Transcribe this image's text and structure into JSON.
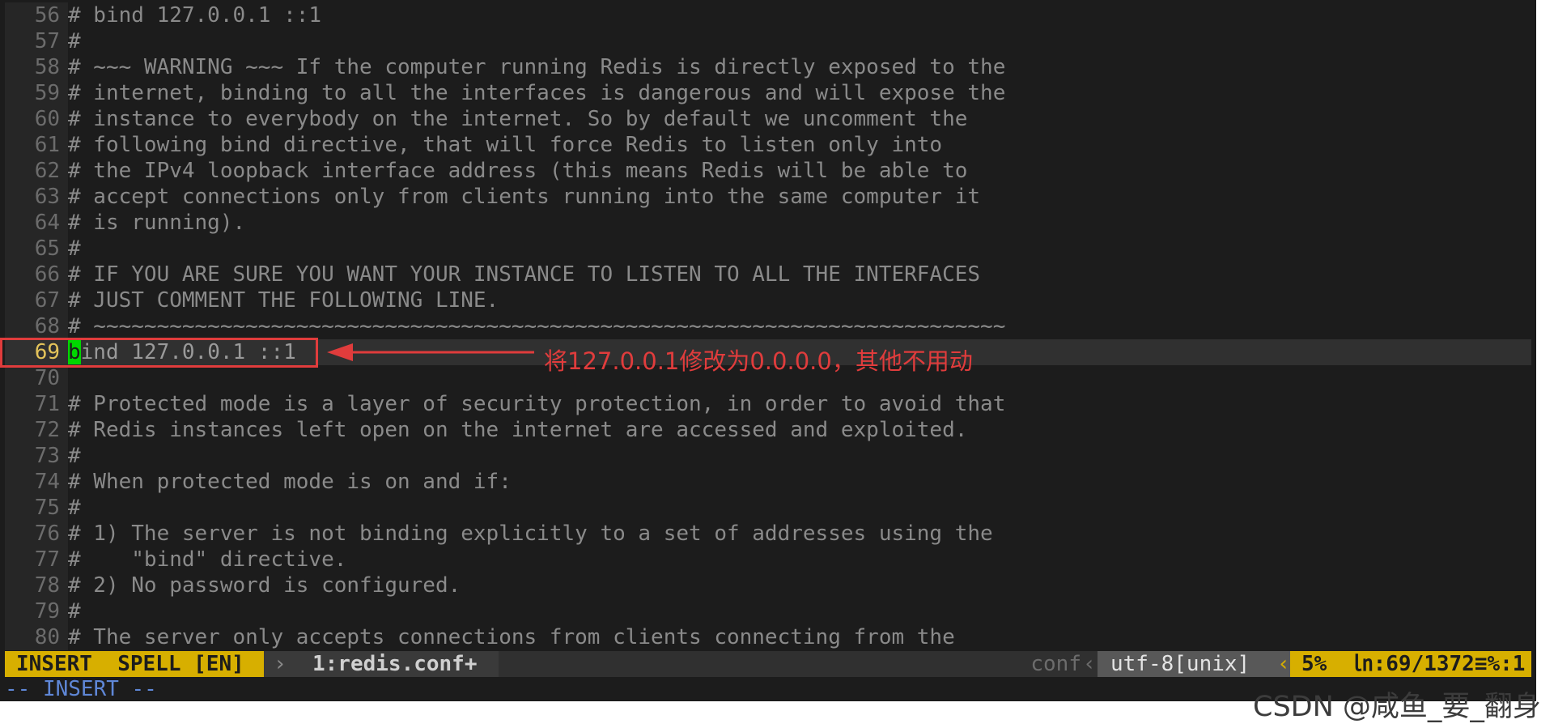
{
  "editor": {
    "lines": [
      {
        "num": "56",
        "text": "# bind 127.0.0.1 ::1"
      },
      {
        "num": "57",
        "text": "#"
      },
      {
        "num": "58",
        "text": "# ~~~ WARNING ~~~ If the computer running Redis is directly exposed to the"
      },
      {
        "num": "59",
        "text": "# internet, binding to all the interfaces is dangerous and will expose the"
      },
      {
        "num": "60",
        "text": "# instance to everybody on the internet. So by default we uncomment the"
      },
      {
        "num": "61",
        "text": "# following bind directive, that will force Redis to listen only into"
      },
      {
        "num": "62",
        "text": "# the IPv4 loopback interface address (this means Redis will be able to"
      },
      {
        "num": "63",
        "text": "# accept connections only from clients running into the same computer it"
      },
      {
        "num": "64",
        "text": "# is running)."
      },
      {
        "num": "65",
        "text": "#"
      },
      {
        "num": "66",
        "text": "# IF YOU ARE SURE YOU WANT YOUR INSTANCE TO LISTEN TO ALL THE INTERFACES"
      },
      {
        "num": "67",
        "text": "# JUST COMMENT THE FOLLOWING LINE."
      },
      {
        "num": "68",
        "text": "# ~~~~~~~~~~~~~~~~~~~~~~~~~~~~~~~~~~~~~~~~~~~~~~~~~~~~~~~~~~~~~~~~~~~~~~~~"
      },
      {
        "num": "69",
        "cursor_char": "b",
        "text": "ind 127.0.0.1 ::1",
        "current": true
      },
      {
        "num": "70",
        "text": ""
      },
      {
        "num": "71",
        "text": "# Protected mode is a layer of security protection, in order to avoid that"
      },
      {
        "num": "72",
        "text": "# Redis instances left open on the internet are accessed and exploited."
      },
      {
        "num": "73",
        "text": "#"
      },
      {
        "num": "74",
        "text": "# When protected mode is on and if:"
      },
      {
        "num": "75",
        "text": "#"
      },
      {
        "num": "76",
        "text": "# 1) The server is not binding explicitly to a set of addresses using the"
      },
      {
        "num": "77",
        "text": "#    \"bind\" directive."
      },
      {
        "num": "78",
        "text": "# 2) No password is configured."
      },
      {
        "num": "79",
        "text": "#"
      },
      {
        "num": "80",
        "text": "# The server only accepts connections from clients connecting from the"
      }
    ]
  },
  "statusline": {
    "mode": "INSERT  SPELL [EN]",
    "sep1": "›",
    "buffer": "1:redis.conf+",
    "filetype": "conf",
    "sep2": "‹",
    "encoding": "utf-8[unix]",
    "sep3": "‹",
    "position": "5%  ㏑:69/1372≡%:1"
  },
  "cmdline": "-- INSERT --",
  "annotation": {
    "text": "将127.0.0.1修改为0.0.0.0，其他不用动",
    "color": "#e03c3c"
  },
  "watermark": "CSDN @咸鱼_要_翻身"
}
